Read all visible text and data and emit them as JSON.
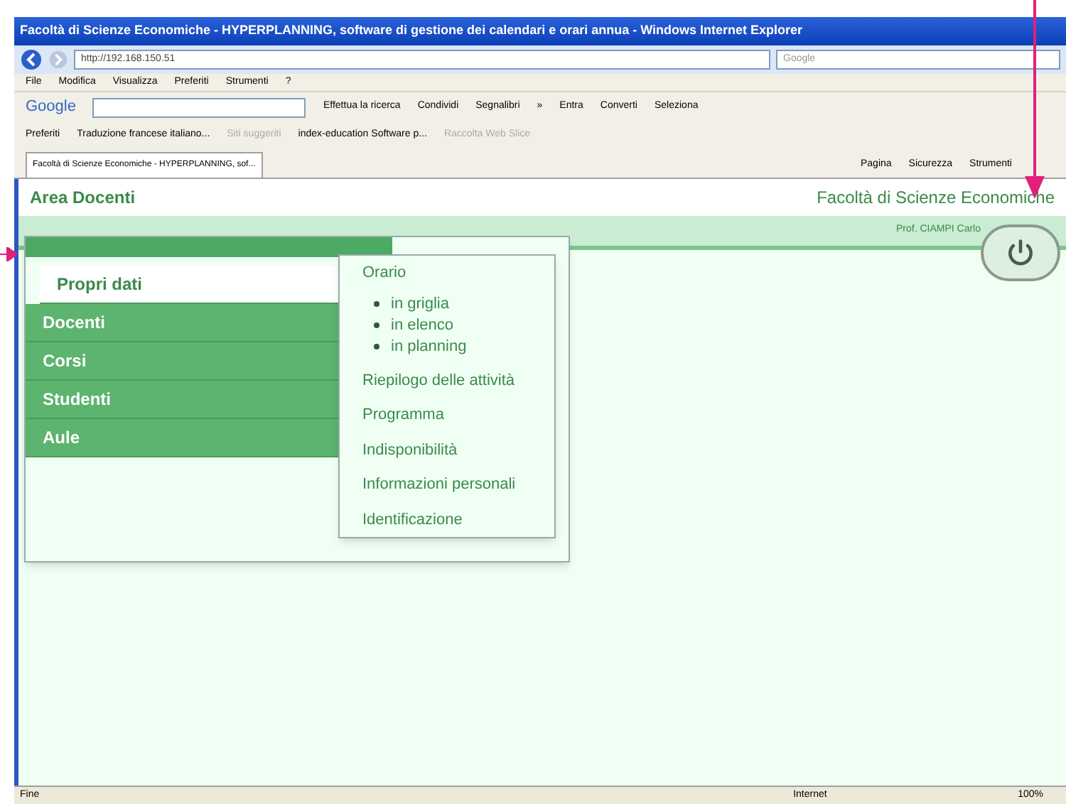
{
  "window": {
    "title": "Facoltà di Scienze Economiche - HYPERPLANNING, software di gestione dei calendari e orari annua - Windows Internet Explorer"
  },
  "address_bar": {
    "value": "http://192.168.150.51",
    "search_placeholder": "Google"
  },
  "menu_bar": [
    "File",
    "Modifica",
    "Visualizza",
    "Preferiti",
    "Strumenti",
    "?"
  ],
  "google_toolbar": {
    "logo": "Google",
    "items": [
      "Effettua la ricerca",
      "Condividi",
      "Segnalibri",
      "»",
      "Entra",
      "Converti",
      "Seleziona"
    ]
  },
  "favorites_bar": [
    "Preferiti",
    "Traduzione francese italiano...",
    "Siti suggeriti",
    "index-education Software p...",
    "Raccolta Web Slice"
  ],
  "tab": {
    "label": "Facoltà di Scienze Economiche - HYPERPLANNING, sof..."
  },
  "command_bar": [
    "Pagina",
    "Sicurezza",
    "Strumenti"
  ],
  "page": {
    "area_title": "Area Docenti",
    "faculty": "Facoltà di Scienze Economiche",
    "user": "Prof. CIAMPI Carlo",
    "menu": [
      {
        "label": "Propri dati",
        "selected": true
      },
      {
        "label": "Docenti",
        "selected": false
      },
      {
        "label": "Corsi",
        "selected": false
      },
      {
        "label": "Studenti",
        "selected": false
      },
      {
        "label": "Aule",
        "selected": false
      }
    ],
    "submenu": [
      {
        "label": "Orario",
        "children": [
          {
            "label": "in griglia"
          },
          {
            "label": "in elenco"
          },
          {
            "label": "in planning"
          }
        ]
      },
      {
        "label": "Riepilogo delle attività"
      },
      {
        "label": "Programma"
      },
      {
        "label": "Indisponibilità"
      },
      {
        "label": "Informazioni personali"
      },
      {
        "label": "Identificazione"
      }
    ]
  },
  "status_bar": {
    "status": "Fine",
    "zone": "Internet",
    "zoom": "100%"
  }
}
